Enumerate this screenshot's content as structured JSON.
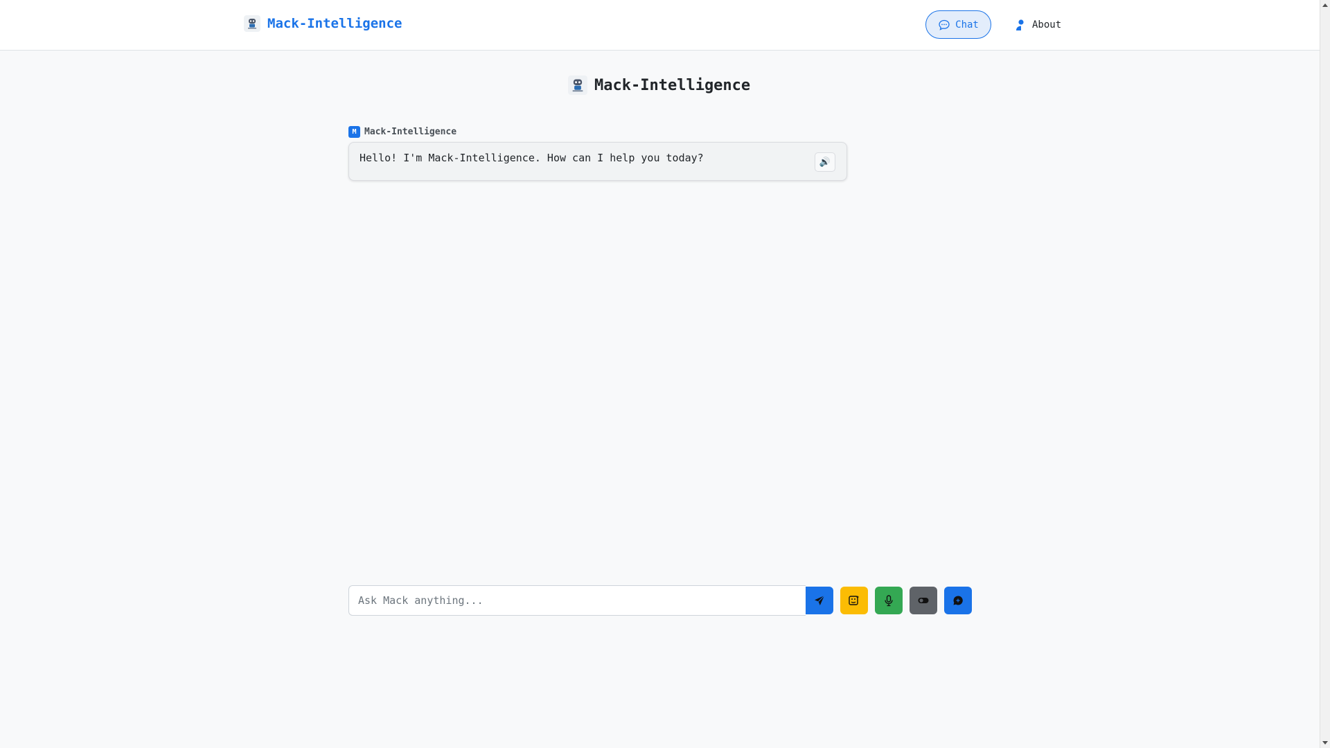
{
  "header": {
    "brand": "Mack-Intelligence",
    "nav": {
      "chat_label": "Chat",
      "about_label": "About"
    }
  },
  "main": {
    "title": "Mack-Intelligence"
  },
  "messages": [
    {
      "sender": "Mack-Intelligence",
      "avatar_letter": "M",
      "text": "Hello! I'm Mack-Intelligence. How can I help you today?",
      "speak_icon": "speaker-icon"
    }
  ],
  "input": {
    "placeholder": "Ask Mack anything..."
  },
  "buttons": {
    "send_icon": "send-icon",
    "image_icon": "image-icon",
    "mic_icon": "microphone-icon",
    "toggle_icon": "toggle-icon",
    "new_chat_icon": "chat-bubble-icon"
  },
  "colors": {
    "brand": "#1a73e8",
    "image_button": "#fbbc04",
    "mic_button": "#34a853",
    "toggle_button": "#5f6368",
    "background": "#f8f9fa"
  }
}
